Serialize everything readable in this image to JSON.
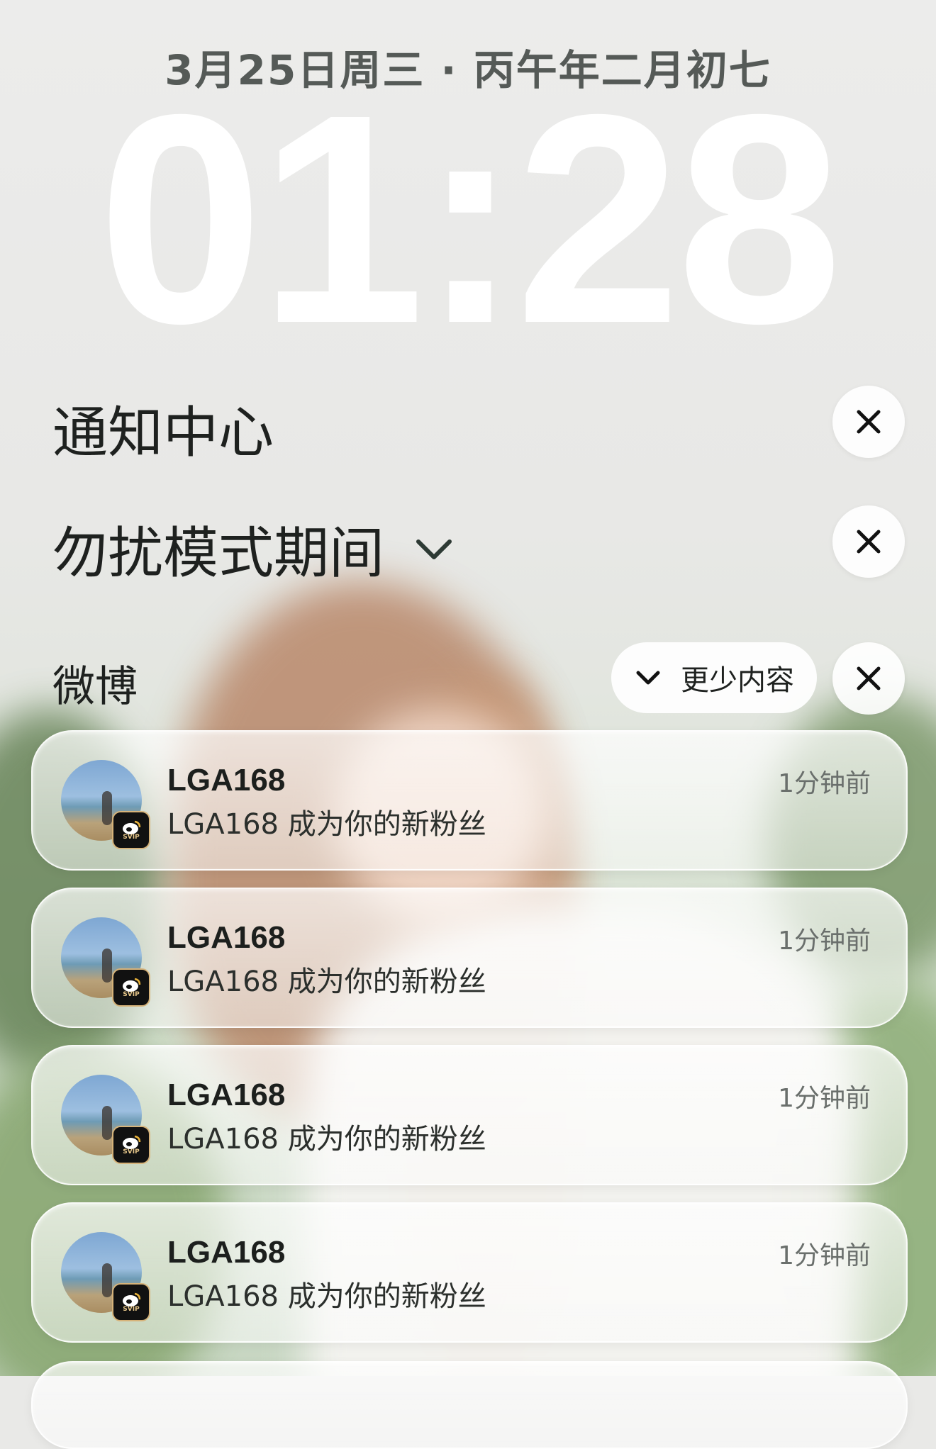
{
  "lockscreen": {
    "date": "3月25日周三 · 丙午年二月初七",
    "time": "01:28"
  },
  "notification_center": {
    "title": "通知中心",
    "dnd_title": "勿扰模式期间"
  },
  "app_group": {
    "app_name": "微博",
    "show_less_label": "更少内容",
    "notifications": [
      {
        "title": "LGA168",
        "body": "LGA168 成为你的新粉丝",
        "time": "1分钟前",
        "badge": "SVIP"
      },
      {
        "title": "LGA168",
        "body": "LGA168 成为你的新粉丝",
        "time": "1分钟前",
        "badge": "SVIP"
      },
      {
        "title": "LGA168",
        "body": "LGA168 成为你的新粉丝",
        "time": "1分钟前",
        "badge": "SVIP"
      },
      {
        "title": "LGA168",
        "body": "LGA168 成为你的新粉丝",
        "time": "1分钟前",
        "badge": "SVIP"
      }
    ]
  },
  "icons": {
    "close": "close-icon",
    "chevron": "chevron-down-icon",
    "app_badge": "weibo-icon"
  },
  "colors": {
    "clock": "#ffffff",
    "badge_gold": "#d6b37a"
  }
}
